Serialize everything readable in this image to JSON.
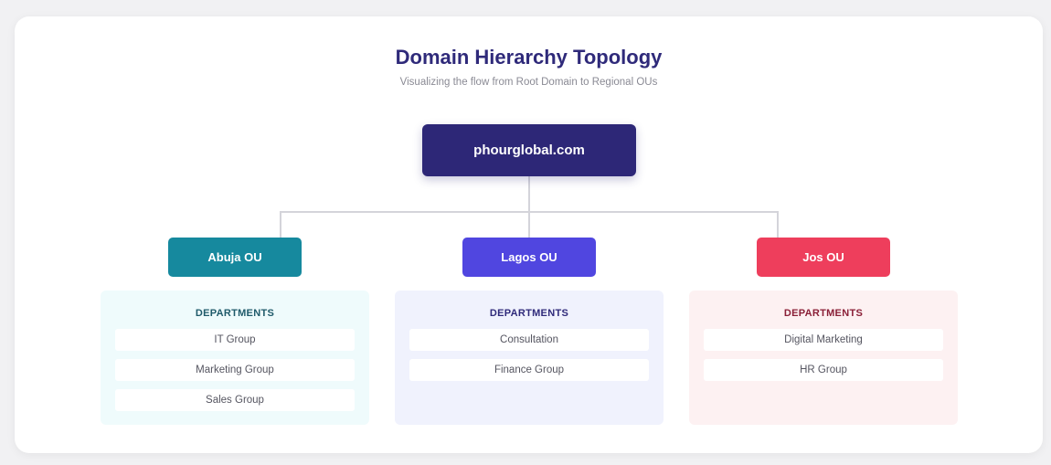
{
  "header": {
    "title": "Domain Hierarchy Topology",
    "subtitle": "Visualizing the flow from Root Domain to Regional OUs"
  },
  "root": {
    "label": "phourglobal.com",
    "color": "#2d2777"
  },
  "ous": [
    {
      "label": "Abuja OU",
      "color": "#16899e",
      "panel_bg": "#effbfc",
      "heading_color": "#1f5a6a",
      "departments_heading": "DEPARTMENTS",
      "departments": [
        "IT Group",
        "Marketing Group",
        "Sales Group"
      ]
    },
    {
      "label": "Lagos OU",
      "color": "#5046e0",
      "panel_bg": "#f0f2fd",
      "heading_color": "#2f2a7a",
      "departments_heading": "DEPARTMENTS",
      "departments": [
        "Consultation",
        "Finance Group"
      ]
    },
    {
      "label": "Jos OU",
      "color": "#ee3e5c",
      "panel_bg": "#fdf1f2",
      "heading_color": "#8a1f37",
      "departments_heading": "DEPARTMENTS",
      "departments": [
        "Digital Marketing",
        "HR Group"
      ]
    }
  ]
}
